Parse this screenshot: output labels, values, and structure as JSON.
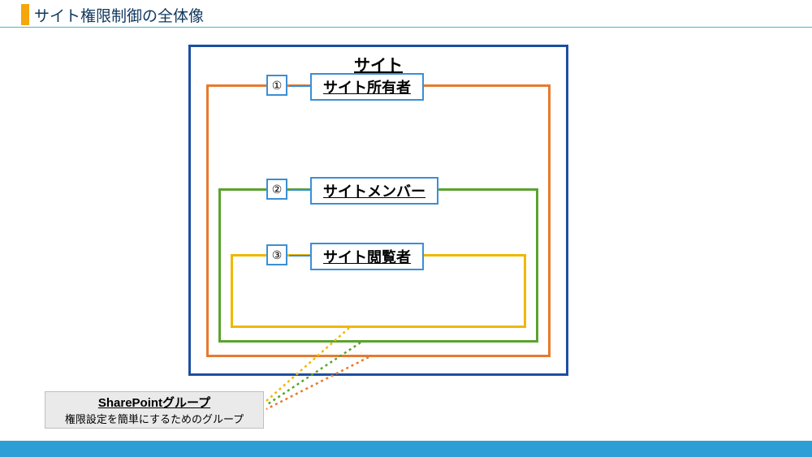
{
  "title": "サイト権限制御の全体像",
  "site": {
    "heading": "サイト"
  },
  "groups": {
    "owner": {
      "num": "①",
      "label": "サイト所有者"
    },
    "member": {
      "num": "②",
      "label": "サイトメンバー"
    },
    "visitor": {
      "num": "③",
      "label": "サイト閲覧者"
    }
  },
  "callout": {
    "title": "SharePointグループ",
    "desc": "権限設定を簡単にするためのグループ"
  },
  "colors": {
    "blue": "#1c4fa1",
    "orange": "#e77a2f",
    "green": "#5aa32e",
    "yellow": "#efb800",
    "accent": "#3b8fd6",
    "footer": "#2d9fd6"
  }
}
